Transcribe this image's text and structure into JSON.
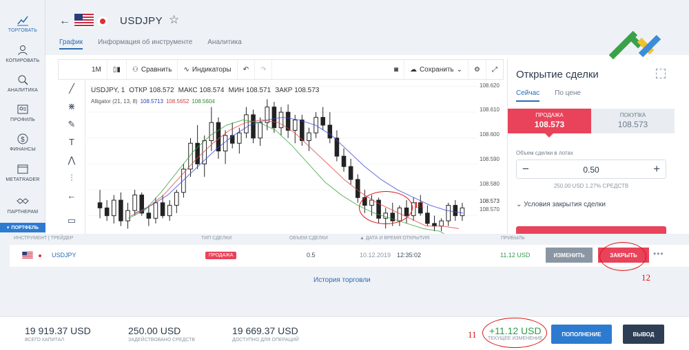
{
  "sidebar": {
    "items": [
      {
        "label": "ТОРГОВАТЬ",
        "icon": "trade-chart-icon",
        "active": true
      },
      {
        "label": "КОПИРОВАТЬ",
        "icon": "copy-user-icon"
      },
      {
        "label": "АНАЛИТИКА",
        "icon": "analytics-icon"
      },
      {
        "label": "ПРОФИЛЬ",
        "icon": "profile-card-icon"
      },
      {
        "label": "ФИНАНСЫ",
        "icon": "dollar-icon"
      },
      {
        "label": "METATRADER",
        "icon": "metatrader-window-icon"
      },
      {
        "label": "ПАРТНЕРАМ",
        "icon": "handshake-icon"
      }
    ],
    "portfolio_label": "ПОРТФЕЛЬ"
  },
  "header": {
    "symbol": "USDJPY",
    "tabs": [
      "График",
      "Информация об инструменте",
      "Аналитика"
    ]
  },
  "toolbar": {
    "timeframe": "1M",
    "compare_label": "Сравнить",
    "indicators_label": "Индикаторы",
    "save_label": "Сохранить"
  },
  "chart_header": {
    "symbol": "USDJPY",
    "interval": "1",
    "open_label": "ОТКР",
    "open": "108.572",
    "high_label": "МАКС",
    "high": "108.574",
    "low_label": "МИН",
    "low": "108.571",
    "close_label": "ЗАКР",
    "close": "108.573",
    "indicator": "Alligator (21, 13, 8)",
    "jaw": "108.5713",
    "teeth": "108.5652",
    "lips": "108.5604"
  },
  "price_axis": {
    "ticks": [
      "108.620",
      "108.610",
      "108.600",
      "108.590",
      "108.580",
      "108.570"
    ],
    "last_price": "108.573"
  },
  "chart_data": {
    "type": "candlestick",
    "ylim": [
      108.563,
      108.622
    ],
    "candles": [
      [
        108.575,
        108.58,
        108.569,
        108.573
      ],
      [
        108.573,
        108.576,
        108.568,
        108.57
      ],
      [
        108.57,
        108.578,
        108.567,
        108.576
      ],
      [
        108.576,
        108.579,
        108.566,
        108.568
      ],
      [
        108.568,
        108.575,
        108.565,
        108.572
      ],
      [
        108.572,
        108.58,
        108.57,
        108.578
      ],
      [
        108.578,
        108.579,
        108.57,
        108.571
      ],
      [
        108.571,
        108.574,
        108.566,
        108.569
      ],
      [
        108.569,
        108.577,
        108.567,
        108.575
      ],
      [
        108.575,
        108.578,
        108.569,
        108.57
      ],
      [
        108.57,
        108.576,
        108.568,
        108.574
      ],
      [
        108.574,
        108.58,
        108.571,
        108.579
      ],
      [
        108.579,
        108.59,
        108.577,
        108.588
      ],
      [
        108.588,
        108.6,
        108.585,
        108.598
      ],
      [
        108.598,
        108.605,
        108.588,
        108.59
      ],
      [
        108.59,
        108.601,
        108.585,
        108.599
      ],
      [
        108.599,
        108.612,
        108.595,
        108.606
      ],
      [
        108.606,
        108.608,
        108.592,
        108.595
      ],
      [
        108.595,
        108.603,
        108.59,
        108.601
      ],
      [
        108.601,
        108.606,
        108.596,
        108.598
      ],
      [
        108.598,
        108.604,
        108.594,
        108.602
      ],
      [
        108.602,
        108.612,
        108.6,
        108.609
      ],
      [
        108.609,
        108.611,
        108.598,
        108.6
      ],
      [
        108.6,
        108.608,
        108.597,
        108.606
      ],
      [
        108.606,
        108.615,
        108.603,
        108.612
      ],
      [
        108.612,
        108.614,
        108.602,
        108.604
      ],
      [
        108.604,
        108.612,
        108.601,
        108.61
      ],
      [
        108.61,
        108.613,
        108.6,
        108.603
      ],
      [
        108.603,
        108.609,
        108.598,
        108.607
      ],
      [
        108.607,
        108.609,
        108.597,
        108.599
      ],
      [
        108.599,
        108.604,
        108.595,
        108.602
      ],
      [
        108.602,
        108.61,
        108.6,
        108.608
      ],
      [
        108.608,
        108.612,
        108.603,
        108.605
      ],
      [
        108.605,
        108.61,
        108.598,
        108.6
      ],
      [
        108.6,
        108.603,
        108.591,
        108.593
      ],
      [
        108.593,
        108.596,
        108.587,
        108.589
      ],
      [
        108.589,
        108.592,
        108.582,
        108.584
      ],
      [
        108.584,
        108.586,
        108.575,
        108.577
      ],
      [
        108.577,
        108.58,
        108.571,
        108.574
      ],
      [
        108.574,
        108.578,
        108.57,
        108.576
      ],
      [
        108.576,
        108.577,
        108.567,
        108.569
      ],
      [
        108.569,
        108.573,
        108.565,
        108.571
      ],
      [
        108.571,
        108.575,
        108.566,
        108.568
      ],
      [
        108.568,
        108.574,
        108.566,
        108.573
      ],
      [
        108.573,
        108.576,
        108.567,
        108.57
      ],
      [
        108.57,
        108.577,
        108.568,
        108.575
      ],
      [
        108.575,
        108.578,
        108.57,
        108.571
      ],
      [
        108.571,
        108.574,
        108.566,
        108.567
      ],
      [
        108.567,
        108.57,
        108.564,
        108.566
      ],
      [
        108.566,
        108.569,
        108.564,
        108.568
      ],
      [
        108.568,
        108.575,
        108.566,
        108.574
      ],
      [
        108.574,
        108.576,
        108.568,
        108.57
      ],
      [
        108.57,
        108.575,
        108.568,
        108.573
      ]
    ],
    "alligator": {
      "jaw": [
        108.571,
        108.574,
        108.578,
        108.584,
        108.59,
        108.596,
        108.601,
        108.605,
        108.607,
        108.608,
        108.607,
        108.605,
        108.601,
        108.595,
        108.589,
        108.584,
        108.58,
        108.577,
        108.574,
        108.572,
        108.571
      ],
      "teeth": [
        108.57,
        108.573,
        108.578,
        108.585,
        108.592,
        108.598,
        108.603,
        108.606,
        108.607,
        108.606,
        108.602,
        108.596,
        108.59,
        108.584,
        108.579,
        108.575,
        108.572,
        108.569,
        108.566,
        108.566,
        108.565
      ],
      "lips": [
        108.569,
        108.572,
        108.579,
        108.587,
        108.595,
        108.601,
        108.605,
        108.607,
        108.606,
        108.603,
        108.597,
        108.59,
        108.583,
        108.578,
        108.574,
        108.571,
        108.569,
        108.567,
        108.565,
        108.564,
        108.56
      ]
    }
  },
  "trade_panel": {
    "title": "Открытие сделки",
    "tabs": [
      "Сейчас",
      "По цене"
    ],
    "sell_label": "ПРОДАЖА",
    "sell_price": "108.573",
    "buy_label": "ПОКУПКА",
    "buy_price": "108.573",
    "volume_label": "Объем сделки в лотах",
    "volume": "0.50",
    "volume_sub": "250.00 USD   1.27% СРЕДСТВ",
    "close_conditions": "Условия закрытия сделки"
  },
  "positions": {
    "headers": {
      "instrument": "ИНСТРУМЕНТ | ТРЕЙДЕР",
      "type": "ТИП СДЕЛКИ",
      "volume": "ОБЪЕМ СДЕЛКИ",
      "time": "▲ ДАТА И ВРЕМЯ ОТКРЫТИЯ",
      "profit": "ПРИБЫЛЬ"
    },
    "rows": [
      {
        "symbol": "USDJPY",
        "type": "ПРОДАЖА",
        "volume": "0.5",
        "date": "10.12.2019",
        "time": "12:35:02",
        "profit": "11.12 USD",
        "modify": "ИЗМЕНИТЬ",
        "close": "ЗАКРЫТЬ"
      }
    ],
    "history_link": "История торговли"
  },
  "footer": {
    "equity": "19 919.37 USD",
    "equity_label": "ВСЕГО КАПИТАЛ",
    "used": "250.00 USD",
    "used_label": "ЗАДЕЙСТВОВАНО СРЕДСТВ",
    "available": "19 669.37 USD",
    "available_label": "ДОСТУПНО ДЛЯ ОПЕРАЦИЙ",
    "pnl": "+11.12 USD",
    "pnl_label": "ТЕКУЩЕЕ ИЗМЕНЕНИЕ",
    "deposit_label": "ПОПОЛНЕНИЕ",
    "withdraw_label": "ВЫВОД"
  },
  "annotations": [
    "10",
    "11",
    "12"
  ],
  "colors": {
    "accent": "#2a6bb3",
    "sell": "#e8435a",
    "profit": "#2e9b4a",
    "jaw": "#3a4ad8",
    "teeth": "#e04545",
    "lips": "#38a038",
    "annotation": "#dd1111"
  }
}
